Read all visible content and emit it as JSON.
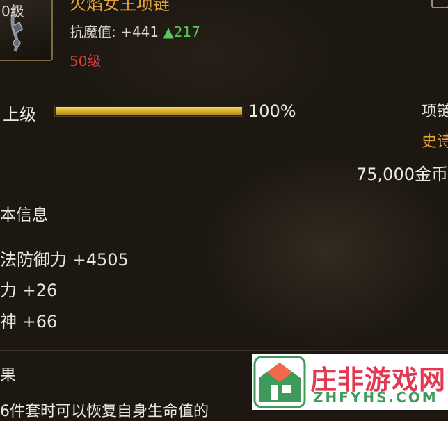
{
  "item": {
    "icon_level": "0级",
    "name": "火焰女王项链",
    "stat_label": "抗魔值:",
    "stat_value": "+441",
    "stat_increase": "▲217",
    "required_level": "50级"
  },
  "upgrade": {
    "label": "上级",
    "progress_text": "100%",
    "progress_fraction": 1.0
  },
  "meta": {
    "slot": "项链",
    "quality": "史诗",
    "price": "75,000金币"
  },
  "basic_info": {
    "title": "本信息",
    "attributes": [
      "法防御力 +4505",
      "力 +26",
      "神 +66"
    ]
  },
  "effect": {
    "title": "果",
    "text": "6件套时可以恢复自身生命值的"
  },
  "watermark": {
    "cn": "庄非游戏网",
    "en": "ZHFYHS.COM"
  },
  "colors": {
    "accent_gold": "#e8a43a",
    "up_green": "#58c85a",
    "level_red": "#d8403d",
    "progress_gold": "#d7b02c"
  }
}
